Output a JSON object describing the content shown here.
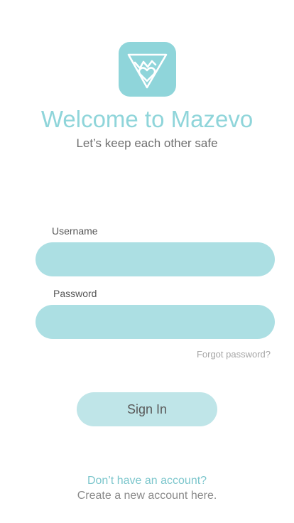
{
  "header": {
    "app_icon": "mazevo-logo-icon",
    "title": "Welcome to Mazevo",
    "subtitle": "Let’s keep each other safe"
  },
  "form": {
    "username_label": "Username",
    "username_value": "",
    "password_label": "Password",
    "password_value": "",
    "forgot_password": "Forgot password?",
    "sign_in_label": "Sign In"
  },
  "footer": {
    "no_account_link": "Don’t have an account?",
    "create_account_text": "Create a new account here."
  },
  "colors": {
    "accent": "#8fd5da",
    "input_bg": "#acdfe3",
    "button_bg": "#bfe5e8",
    "subtitle_text": "#6f6f6f"
  }
}
